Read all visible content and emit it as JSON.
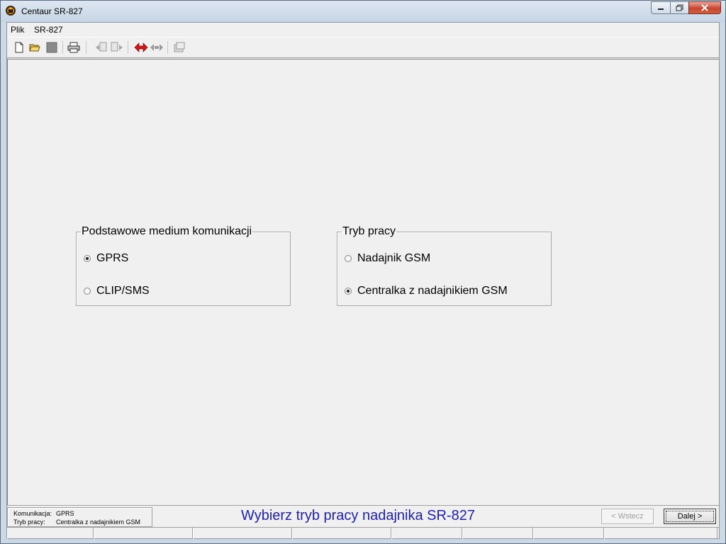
{
  "window": {
    "title": "Centaur SR-827",
    "app_icon": "centaur-app-icon"
  },
  "menu": {
    "items": [
      "Plik",
      "SR-827"
    ]
  },
  "toolbar": {
    "buttons": [
      {
        "name": "new-icon"
      },
      {
        "name": "open-icon"
      },
      {
        "name": "save-icon"
      },
      {
        "name": "print-icon"
      },
      {
        "name": "copy-left-icon"
      },
      {
        "name": "copy-right-icon"
      },
      {
        "name": "transfer-icon"
      },
      {
        "name": "disconnect-icon"
      },
      {
        "name": "settings-icon"
      }
    ]
  },
  "groups": {
    "medium": {
      "legend": "Podstawowe medium komunikacji",
      "options": [
        {
          "label": "GPRS",
          "checked": true
        },
        {
          "label": "CLIP/SMS",
          "checked": false
        }
      ]
    },
    "mode": {
      "legend": "Tryb pracy",
      "options": [
        {
          "label": "Nadajnik GSM",
          "checked": false
        },
        {
          "label": "Centralka z nadajnikiem GSM",
          "checked": true
        }
      ]
    }
  },
  "status": {
    "comm_key": "Komunikacja:",
    "comm_val": "GPRS",
    "mode_key": "Tryb pracy:",
    "mode_val": "Centralka z nadajnikiem GSM"
  },
  "prompt": "Wybierz tryb pracy nadajnika SR-827",
  "nav": {
    "back": "< Wstecz",
    "next": "Dalej >"
  },
  "colors": {
    "prompt": "#1f1fb0",
    "client_bg": "#f0f0f0"
  }
}
